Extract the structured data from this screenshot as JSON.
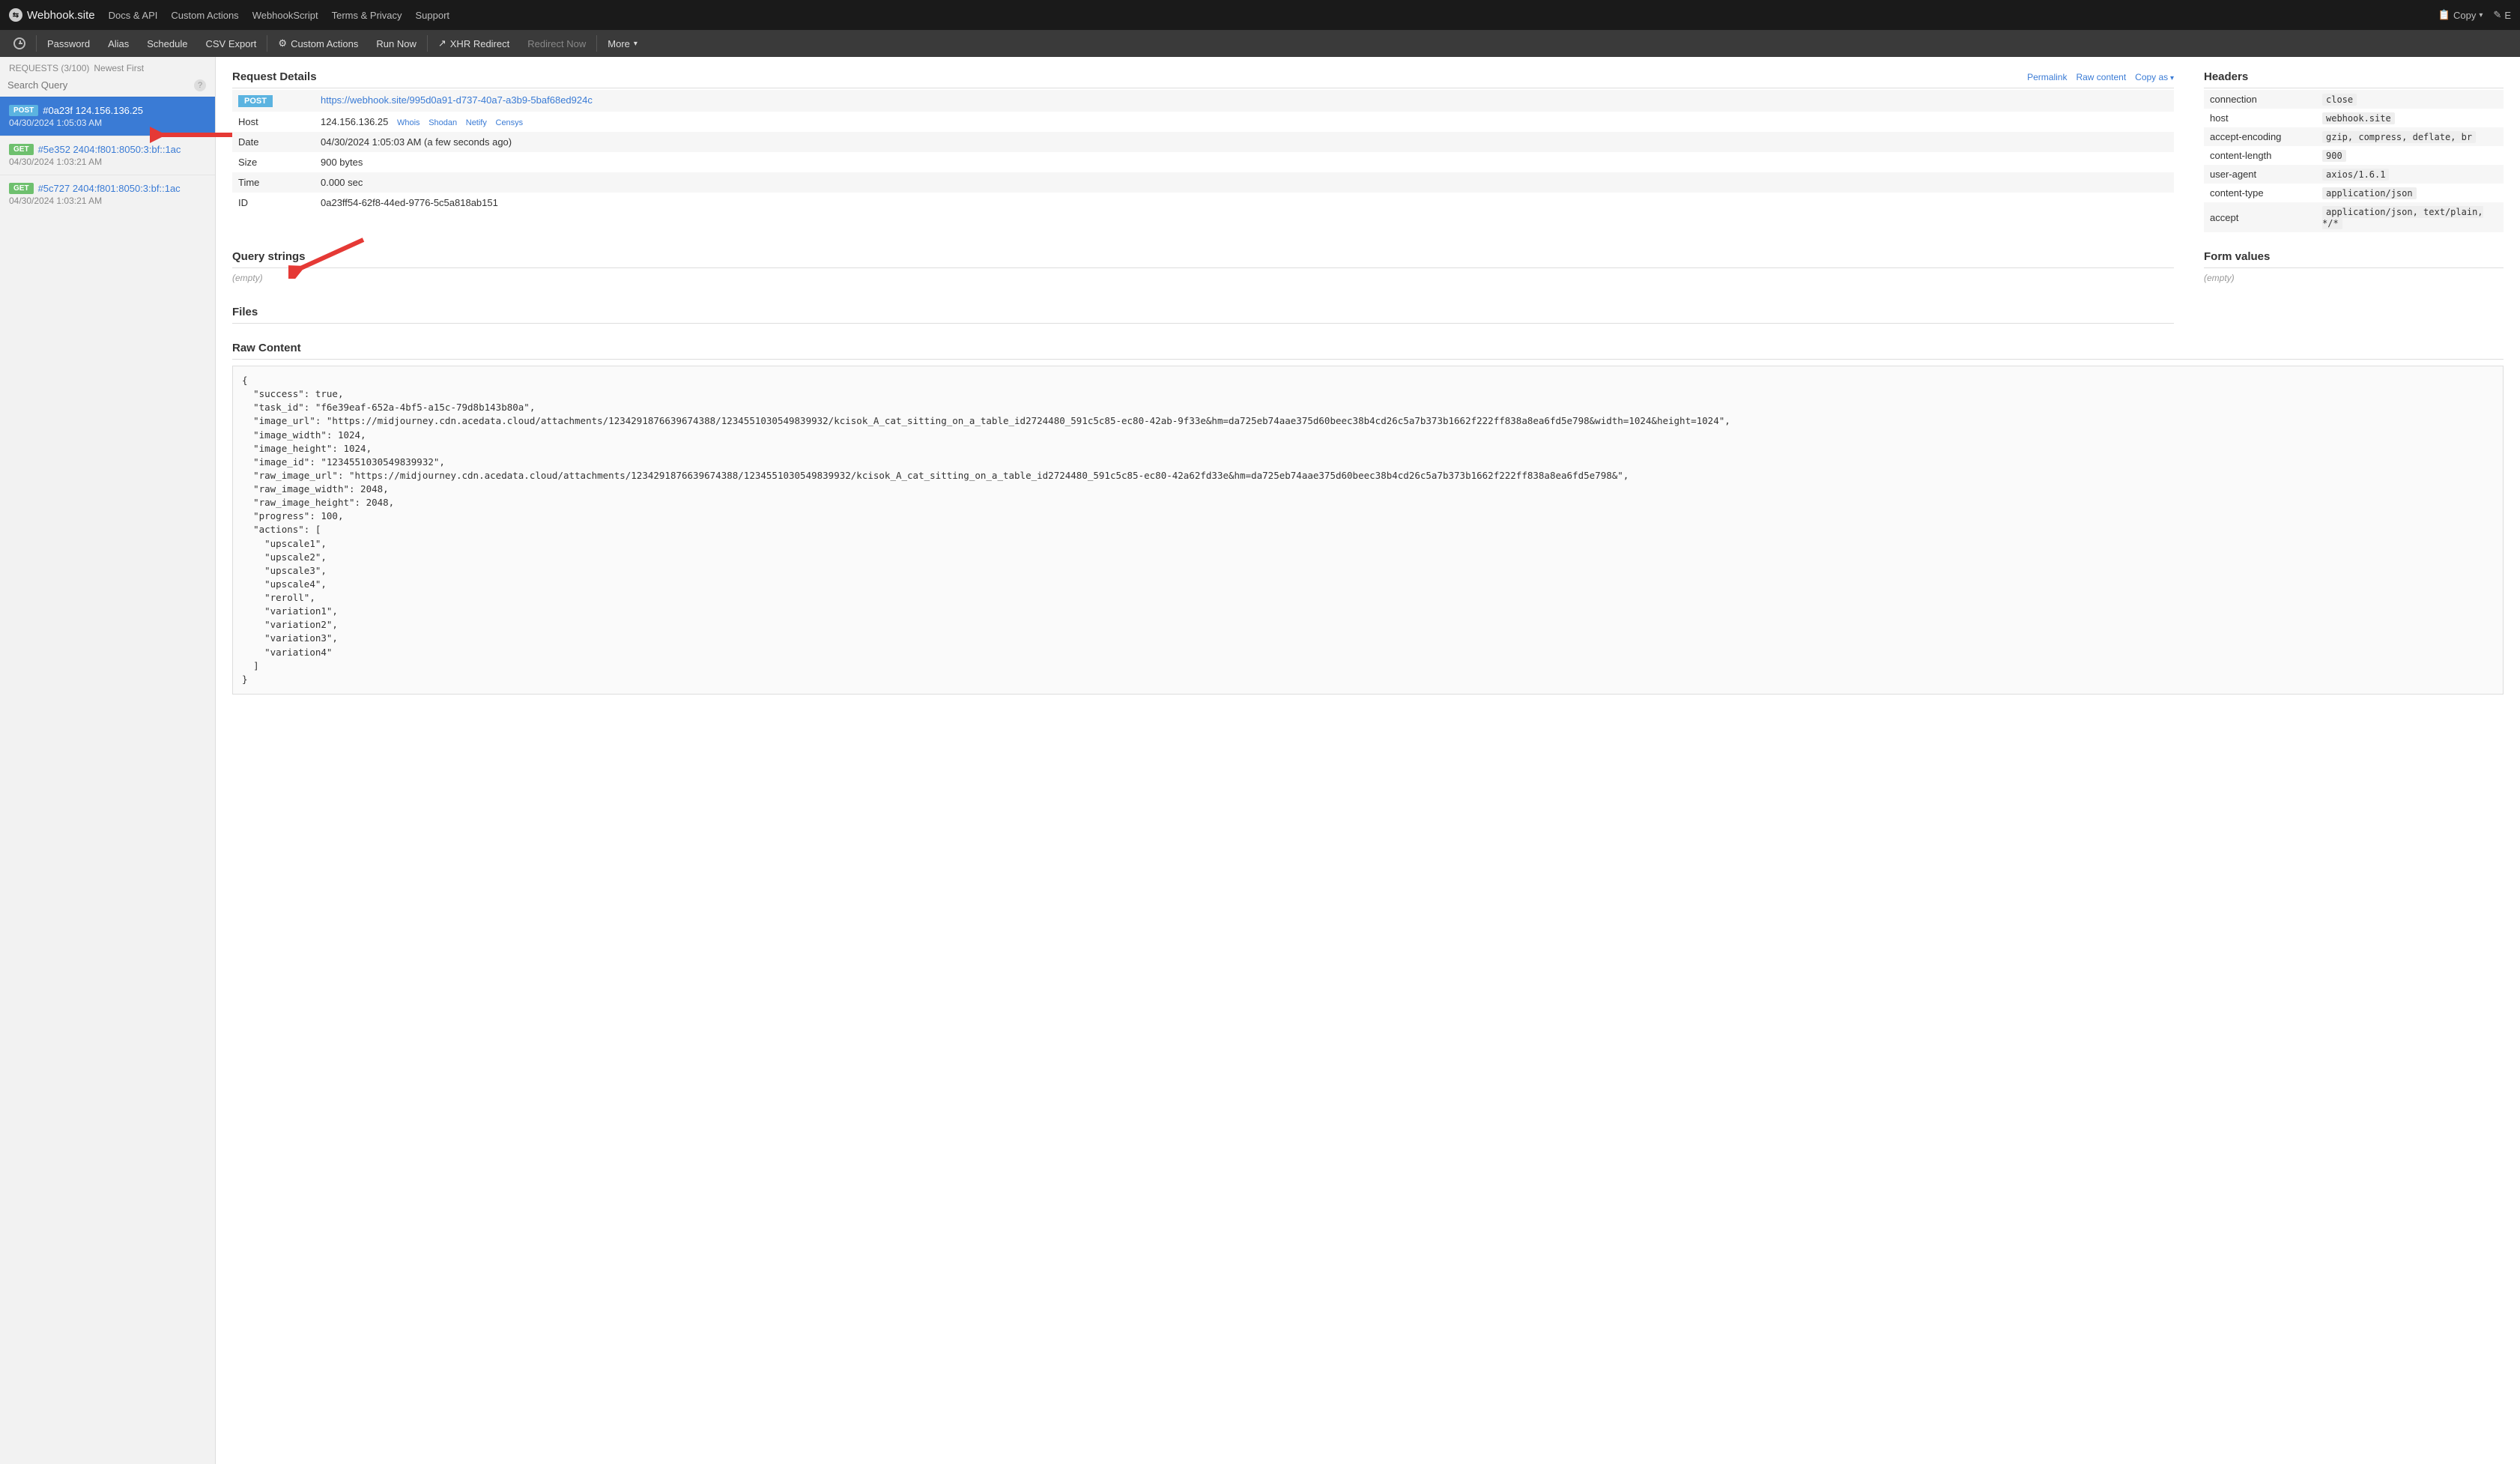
{
  "top_nav": {
    "brand": "Webhook.site",
    "links": [
      "Docs & API",
      "Custom Actions",
      "WebhookScript",
      "Terms & Privacy",
      "Support"
    ],
    "right": {
      "copy": "Copy",
      "edit": "E"
    }
  },
  "sub_nav": {
    "items": [
      "Password",
      "Alias",
      "Schedule",
      "CSV Export"
    ],
    "custom_actions": "Custom Actions",
    "run_now": "Run Now",
    "xhr_redirect": "XHR Redirect",
    "redirect_now": "Redirect Now",
    "more": "More"
  },
  "sidebar": {
    "requests_label": "REQUESTS (3/100)",
    "newest": "Newest First",
    "search_placeholder": "Search Query",
    "items": [
      {
        "method": "POST",
        "hash": "#0a23f",
        "ip": "124.156.136.25",
        "date": "04/30/2024 1:05:03 AM",
        "selected": true
      },
      {
        "method": "GET",
        "hash": "#5e352",
        "ip": "2404:f801:8050:3:bf::1ac",
        "date": "04/30/2024 1:03:21 AM",
        "selected": false
      },
      {
        "method": "GET",
        "hash": "#5c727",
        "ip": "2404:f801:8050:3:bf::1ac",
        "date": "04/30/2024 1:03:21 AM",
        "selected": false
      }
    ]
  },
  "request_details": {
    "title": "Request Details",
    "links": {
      "permalink": "Permalink",
      "raw_content": "Raw content",
      "copy_as": "Copy as"
    },
    "method_badge": "POST",
    "url": "https://webhook.site/995d0a91-d737-40a7-a3b9-5baf68ed924c",
    "rows": {
      "host_label": "Host",
      "host": "124.156.136.25",
      "host_links": [
        "Whois",
        "Shodan",
        "Netify",
        "Censys"
      ],
      "date_label": "Date",
      "date": "04/30/2024 1:05:03 AM (a few seconds ago)",
      "size_label": "Size",
      "size": "900 bytes",
      "time_label": "Time",
      "time": "0.000 sec",
      "id_label": "ID",
      "id": "0a23ff54-62f8-44ed-9776-5c5a818ab151"
    }
  },
  "headers": {
    "title": "Headers",
    "rows": [
      {
        "name": "connection",
        "value": "close"
      },
      {
        "name": "host",
        "value": "webhook.site"
      },
      {
        "name": "accept-encoding",
        "value": "gzip, compress, deflate, br"
      },
      {
        "name": "content-length",
        "value": "900"
      },
      {
        "name": "user-agent",
        "value": "axios/1.6.1"
      },
      {
        "name": "content-type",
        "value": "application/json"
      },
      {
        "name": "accept",
        "value": "application/json, text/plain, */*"
      }
    ]
  },
  "query_strings": {
    "title": "Query strings",
    "empty": "(empty)"
  },
  "form_values": {
    "title": "Form values",
    "empty": "(empty)"
  },
  "files": {
    "title": "Files"
  },
  "raw_content": {
    "title": "Raw Content",
    "body": "{\n  \"success\": true,\n  \"task_id\": \"f6e39eaf-652a-4bf5-a15c-79d8b143b80a\",\n  \"image_url\": \"https://midjourney.cdn.acedata.cloud/attachments/1234291876639674388/1234551030549839932/kcisok_A_cat_sitting_on_a_table_id2724480_591c5c85-ec80-42ab-9f33e&hm=da725eb74aae375d60beec38b4cd26c5a7b373b1662f222ff838a8ea6fd5e798&width=1024&height=1024\",\n  \"image_width\": 1024,\n  \"image_height\": 1024,\n  \"image_id\": \"1234551030549839932\",\n  \"raw_image_url\": \"https://midjourney.cdn.acedata.cloud/attachments/1234291876639674388/1234551030549839932/kcisok_A_cat_sitting_on_a_table_id2724480_591c5c85-ec80-42a62fd33e&hm=da725eb74aae375d60beec38b4cd26c5a7b373b1662f222ff838a8ea6fd5e798&\",\n  \"raw_image_width\": 2048,\n  \"raw_image_height\": 2048,\n  \"progress\": 100,\n  \"actions\": [\n    \"upscale1\",\n    \"upscale2\",\n    \"upscale3\",\n    \"upscale4\",\n    \"reroll\",\n    \"variation1\",\n    \"variation2\",\n    \"variation3\",\n    \"variation4\"\n  ]\n}"
  }
}
